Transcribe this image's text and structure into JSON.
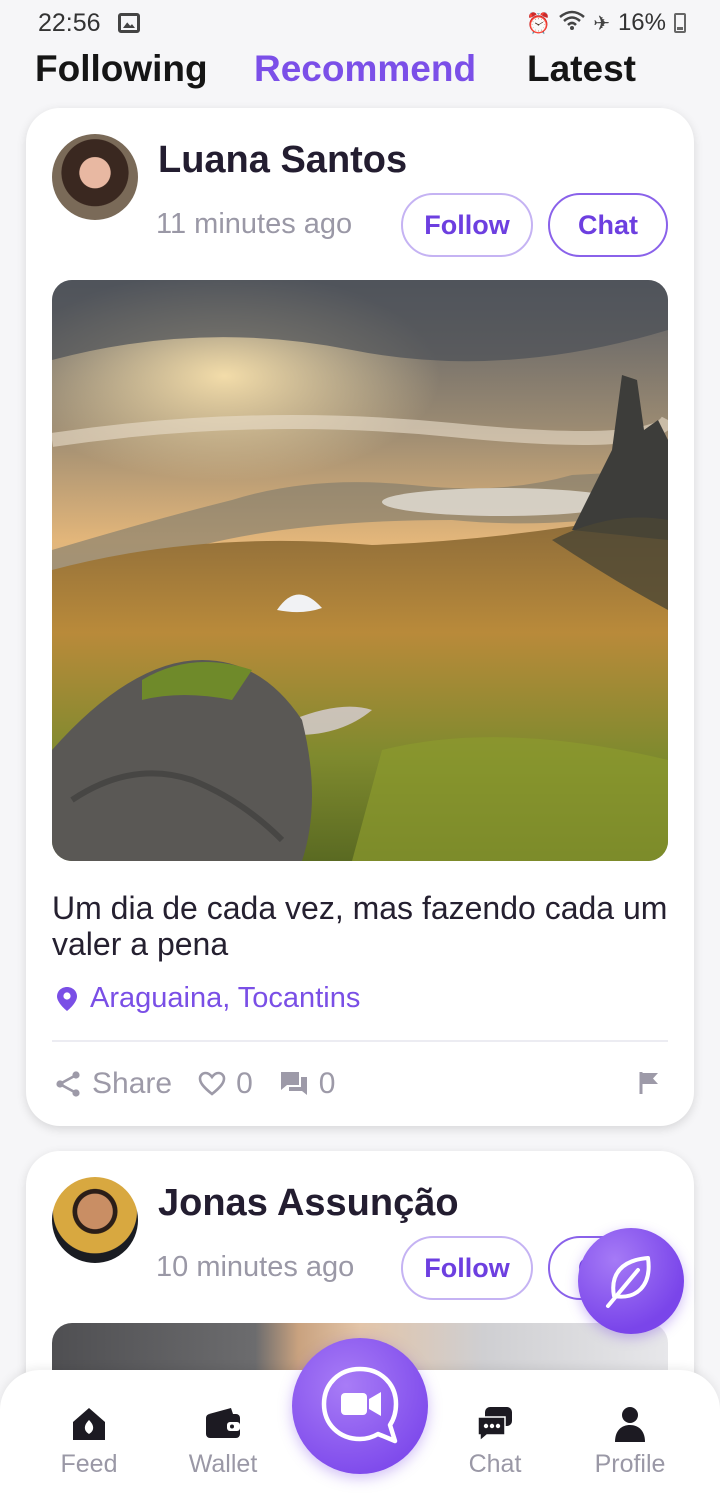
{
  "status_bar": {
    "time": "22:56",
    "battery": "16%",
    "icons": [
      "gallery-icon",
      "alarm-icon",
      "wifi-icon",
      "airplane-icon",
      "battery-icon"
    ]
  },
  "tabs": {
    "following": "Following",
    "recommend": "Recommend",
    "latest": "Latest",
    "active": "Recommend"
  },
  "colors": {
    "accent": "#7b4fe8",
    "muted": "#9a98a6",
    "text": "#231d30"
  },
  "posts": [
    {
      "author": "Luana Santos",
      "time": "11 minutes ago",
      "follow_label": "Follow",
      "chat_label": "Chat",
      "image": "landscape-photo",
      "caption": "Um dia de cada vez, mas fazendo cada um valer a pena",
      "location": "Araguaina, Tocantins",
      "share_label": "Share",
      "likes": "0",
      "comments": "0"
    },
    {
      "author": "Jonas Assunção",
      "time": "10 minutes ago",
      "follow_label": "Follow",
      "chat_label": "Chat",
      "image": "portrait-photo"
    }
  ],
  "bottom_nav": {
    "feed": "Feed",
    "wallet": "Wallet",
    "chat": "Chat",
    "profile": "Profile"
  }
}
